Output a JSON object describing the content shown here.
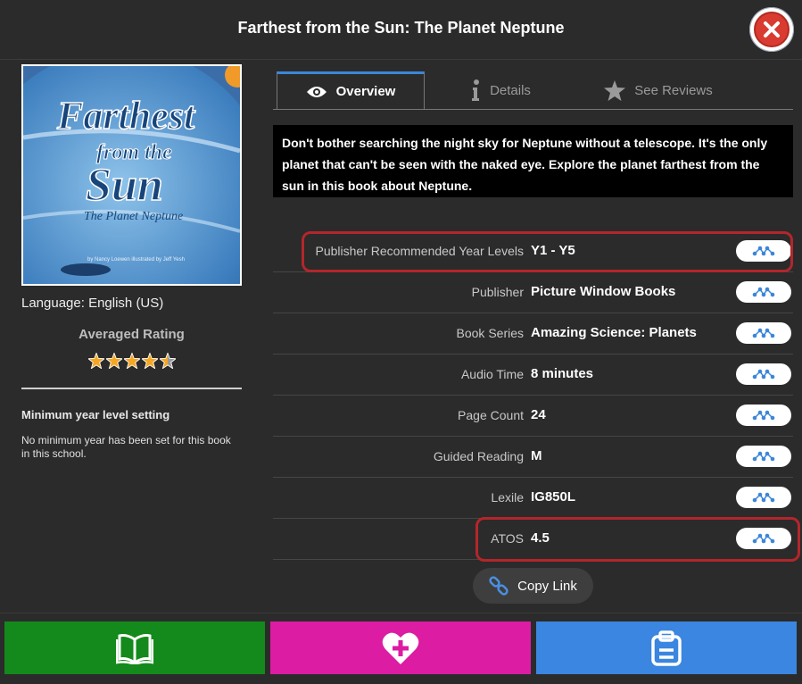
{
  "window": {
    "title": "Farthest from the Sun: The Planet Neptune"
  },
  "book": {
    "cover": {
      "title_line1": "Farthest",
      "title_line2": "from the",
      "title_line3": "Sun",
      "subtitle": "The Planet Neptune",
      "credits": "by Nancy Loewen    illustrated by Jeff Yesh"
    },
    "language": "Language: English (US)",
    "rating": {
      "title": "Averaged Rating",
      "value": 4.5,
      "max": 5
    },
    "min_year": {
      "title": "Minimum year level setting",
      "text": "No minimum year has been set for this book in this school."
    }
  },
  "tabs": [
    {
      "label": "Overview",
      "icon": "eye-icon",
      "active": true
    },
    {
      "label": "Details",
      "icon": "info-icon",
      "active": false
    },
    {
      "label": "See Reviews",
      "icon": "star-icon",
      "active": false
    }
  ],
  "description": "Don't bother searching the night sky for Neptune without a telescope. It's the only planet that can't be seen with the naked eye. Explore the planet farthest from the sun in this book about Neptune.",
  "properties": [
    {
      "label": "Publisher Recommended Year Levels",
      "value": "Y1 - Y5"
    },
    {
      "label": "Publisher",
      "value": "Picture Window Books"
    },
    {
      "label": "Book Series",
      "value": "Amazing Science: Planets"
    },
    {
      "label": "Audio Time",
      "value": "8 minutes"
    },
    {
      "label": "Page Count",
      "value": "24"
    },
    {
      "label": "Guided Reading",
      "value": "M"
    },
    {
      "label": "Lexile",
      "value": "IG850L"
    },
    {
      "label": "ATOS",
      "value": "4.5"
    }
  ],
  "copy_link": {
    "label": "Copy Link",
    "icon": "link-icon"
  },
  "bottom_buttons": [
    {
      "icon": "open-book-icon",
      "color": "#138a1b"
    },
    {
      "icon": "heart-plus-icon",
      "color": "#dc1ca3"
    },
    {
      "icon": "clipboard-icon",
      "color": "#3b86e0"
    }
  ],
  "colors": {
    "accent": "#3b86d9",
    "highlight": "#b3262b",
    "close": "#d93b30"
  }
}
